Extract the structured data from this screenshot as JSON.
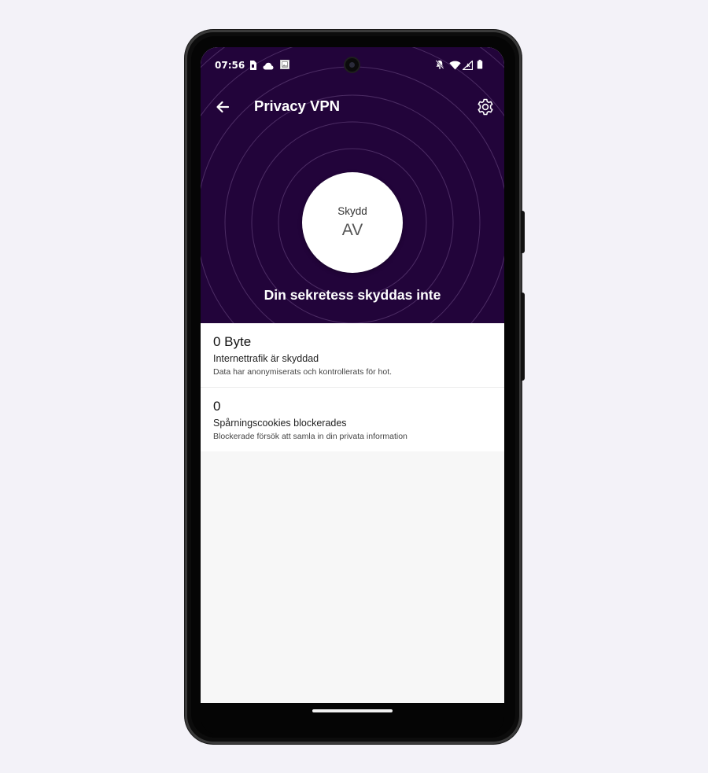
{
  "statusbar": {
    "time": "07:56",
    "left_icons": [
      "sim-card-icon",
      "cloud-icon",
      "photo-icon"
    ],
    "right_icons": [
      "bell-off-icon",
      "wifi-icon",
      "signal-icon",
      "battery-icon"
    ]
  },
  "appbar": {
    "title": "Privacy VPN",
    "back_icon": "arrow-left-icon",
    "settings_icon": "gear-icon"
  },
  "protection": {
    "label": "Skydd",
    "state": "AV"
  },
  "status_message": "Din sekretess skyddas inte",
  "stats": [
    {
      "value": "0 Byte",
      "title": "Internettrafik är skyddad",
      "description": "Data har anonymiserats och kontrollerats för hot."
    },
    {
      "value": "0",
      "title": "Spårningscookies blockerades",
      "description": "Blockerade försök att samla in din privata information"
    }
  ],
  "colors": {
    "hero_background": "#22043a",
    "content_background": "#f7f7f7",
    "page_background": "#f3f2f8"
  }
}
